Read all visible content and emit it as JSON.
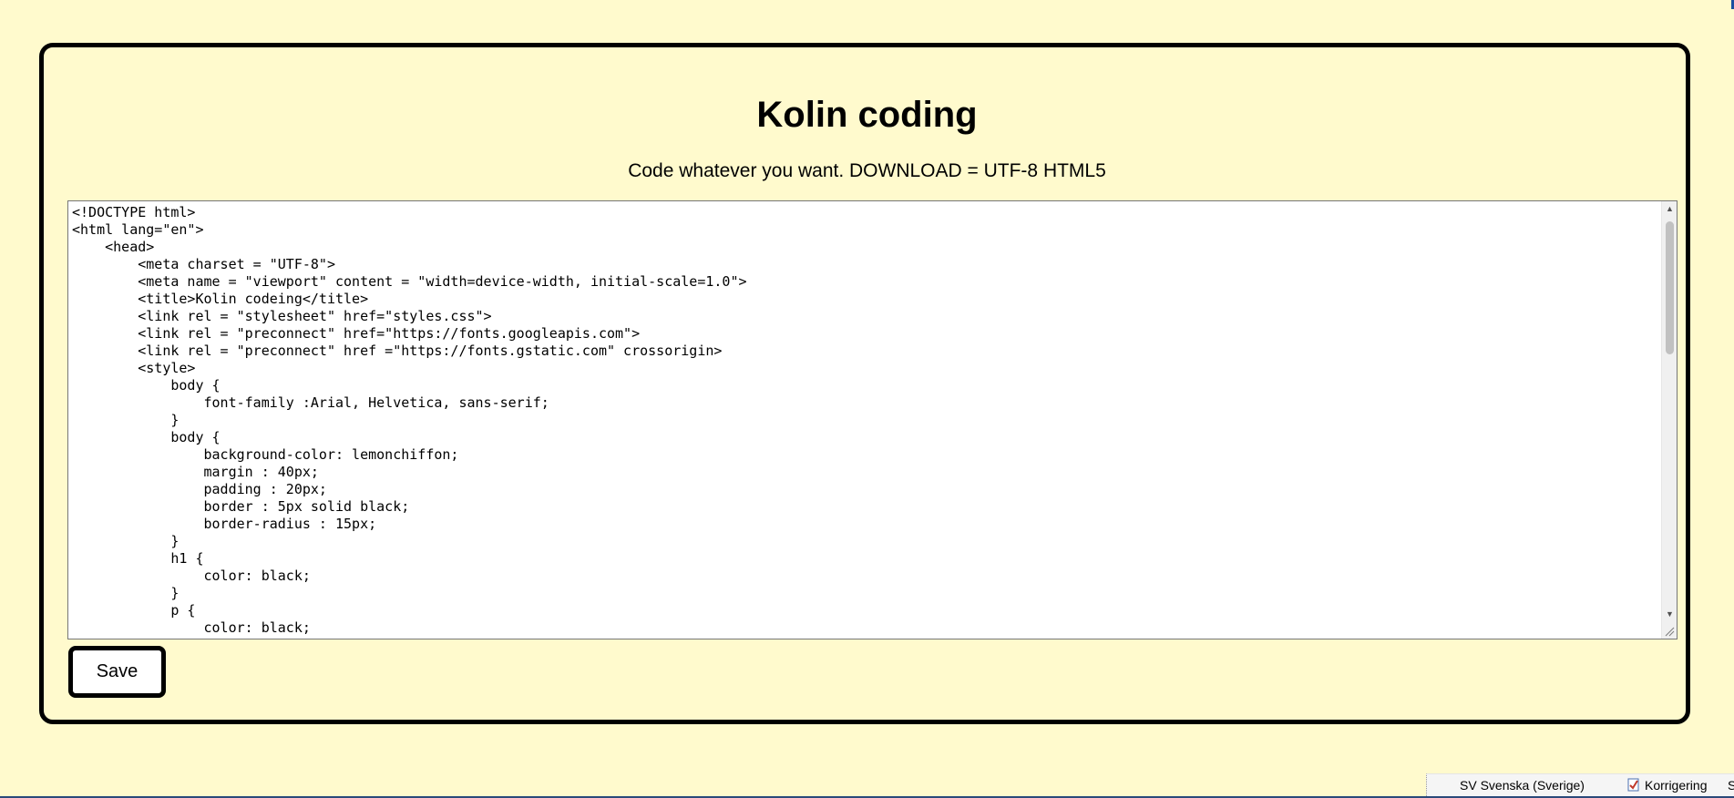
{
  "page": {
    "title": "Kolin coding",
    "subtitle": "Code whatever you want. DOWNLOAD = UTF-8 HTML5"
  },
  "editor": {
    "code": "<!DOCTYPE html>\n<html lang=\"en\">\n    <head>\n        <meta charset = \"UTF-8\">\n        <meta name = \"viewport\" content = \"width=device-width, initial-scale=1.0\">\n        <title>Kolin codeing</title>\n        <link rel = \"stylesheet\" href=\"styles.css\">\n        <link rel = \"preconnect\" href=\"https://fonts.googleapis.com\">\n        <link rel = \"preconnect\" href =\"https://fonts.gstatic.com\" crossorigin>\n        <style>\n            body {\n                font-family :Arial, Helvetica, sans-serif;\n            }\n            body {\n                background-color: lemonchiffon;\n                margin : 40px;\n                padding : 20px;\n                border : 5px solid black;\n                border-radius : 15px;\n            }\n            h1 {\n                color: black;\n            }\n            p {\n                color: black;\n            }\n        </style>\n    </head>"
  },
  "buttons": {
    "save_label": "Save"
  },
  "taskbar": {
    "language_label": "SV Svenska (Sverige)",
    "spellcheck_label": "Korrigering",
    "extra_label": "S"
  },
  "icons": {
    "scroll_up": "scroll-up-arrow-icon",
    "scroll_down": "scroll-down-arrow-icon",
    "resize": "resize-grip-icon",
    "spellcheck": "spellcheck-icon"
  },
  "colors": {
    "background": "#fffacd",
    "border": "#000000",
    "editor_background": "#ffffff"
  }
}
